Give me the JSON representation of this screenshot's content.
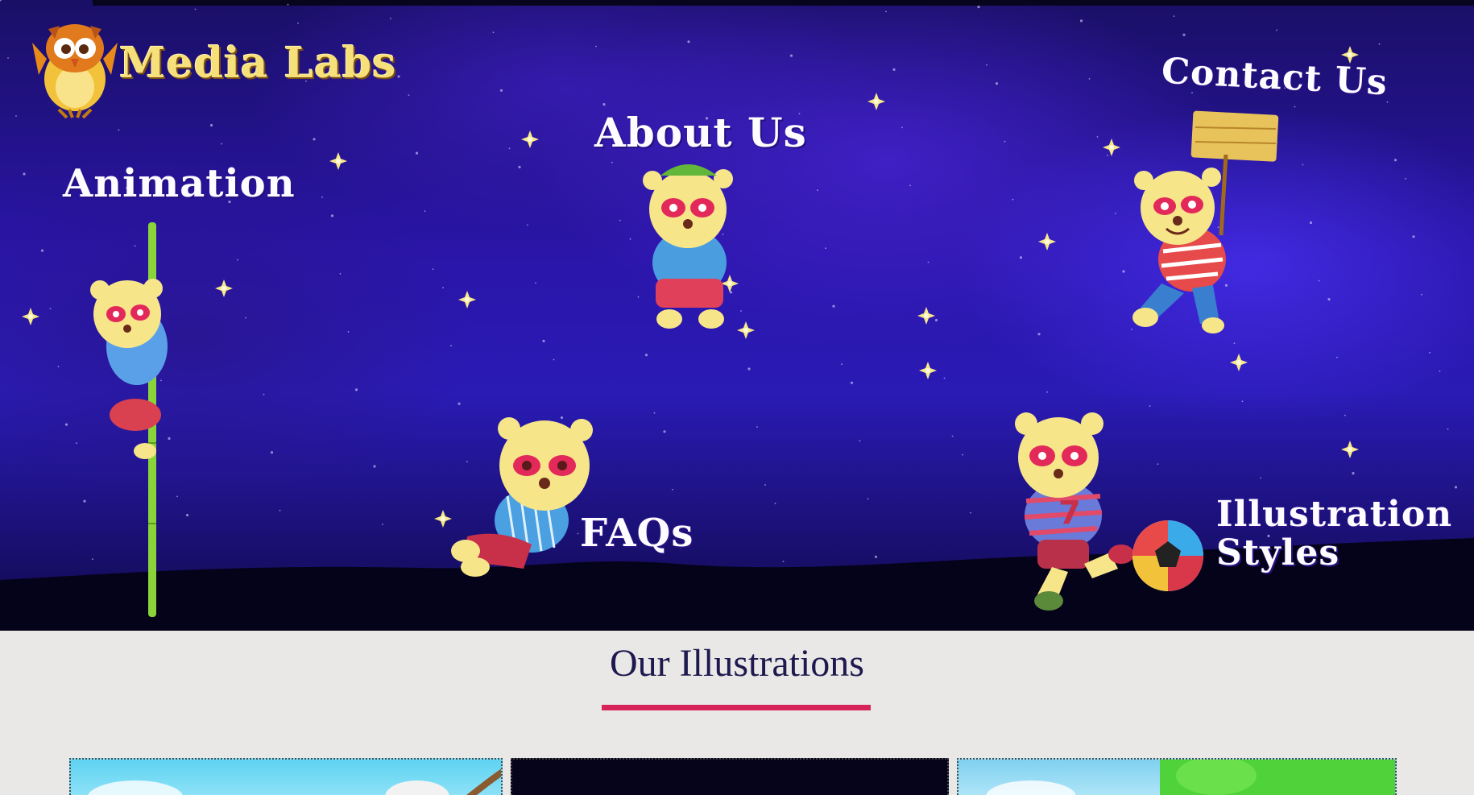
{
  "brand": {
    "name": "Media Labs",
    "icon": "owl-logo-icon"
  },
  "nav": {
    "animation": "Animation",
    "about": "About Us",
    "contact": "Contact Us",
    "faqs": "FAQs",
    "illustration_line1": "Illustration",
    "illustration_line2": "Styles"
  },
  "section": {
    "title": "Our Illustrations"
  },
  "colors": {
    "accent": "#d6245a",
    "title": "#1e1a4f",
    "sky": "#2a15a8",
    "logo": "#f6e07a"
  },
  "thumbnails": [
    {
      "icon": "sky-scene-image"
    },
    {
      "icon": "night-scene-image"
    },
    {
      "icon": "forest-scene-image"
    }
  ]
}
